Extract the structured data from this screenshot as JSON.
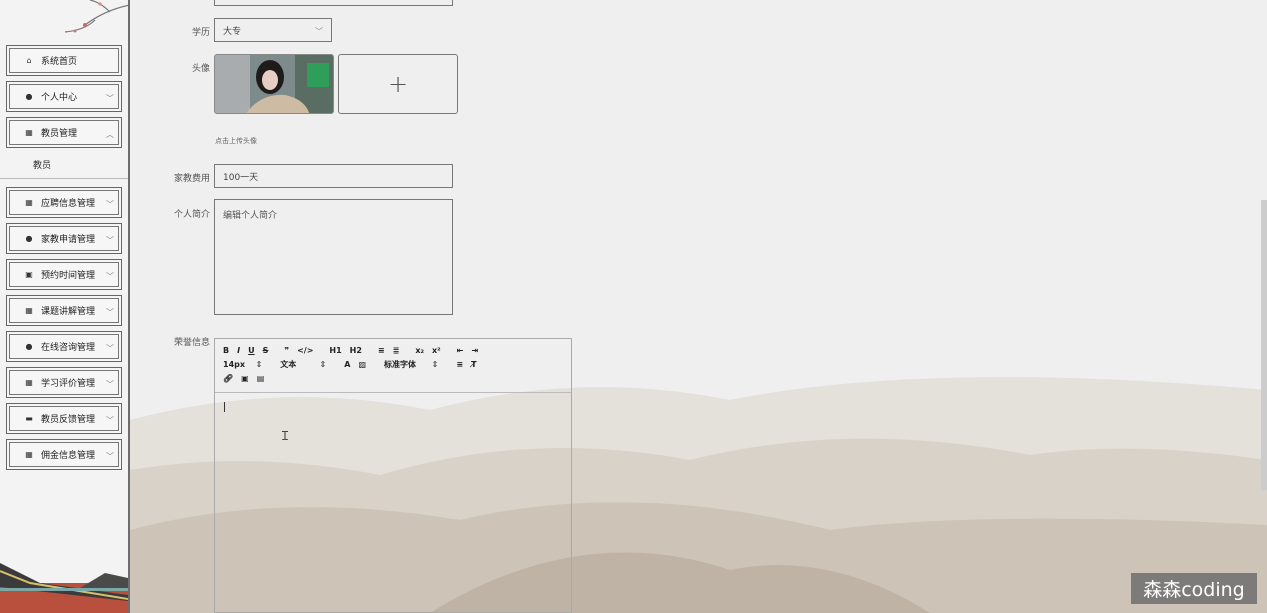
{
  "sidebar": {
    "items": [
      {
        "label": "系统首页",
        "icon": "home-icon",
        "chevron": false
      },
      {
        "label": "个人中心",
        "icon": "user-icon",
        "chevron": true
      },
      {
        "label": "教员管理",
        "icon": "grid-icon",
        "chevron": true,
        "expanded": true
      }
    ],
    "submenu_label": "教员",
    "items2": [
      {
        "label": "应聘信息管理",
        "icon": "grid-icon"
      },
      {
        "label": "家教申请管理",
        "icon": "user-icon"
      },
      {
        "label": "预约时间管理",
        "icon": "calendar-icon"
      },
      {
        "label": "课题讲解管理",
        "icon": "grid-icon"
      },
      {
        "label": "在线咨询管理",
        "icon": "user-icon"
      },
      {
        "label": "学习评价管理",
        "icon": "grid-icon"
      },
      {
        "label": "教员反馈管理",
        "icon": "chat-icon"
      },
      {
        "label": "佣金信息管理",
        "icon": "grid-icon"
      }
    ]
  },
  "form": {
    "education_label": "学历",
    "education_value": "大专",
    "avatar_label": "头像",
    "upload_plus": "+",
    "upload_hint": "点击上传头像",
    "fee_label": "家教费用",
    "fee_value": "100一天",
    "intro_label": "个人简介",
    "intro_placeholder": "编辑个人简介",
    "honor_label": "荣誉信息"
  },
  "editor": {
    "font_size": "14px",
    "text_type": "文本",
    "font_family": "标准字体",
    "buttons": [
      "B",
      "I",
      "U",
      "S",
      "❞",
      "</>",
      "H1",
      "H2",
      "≡",
      "≣",
      "x₂",
      "x²",
      "⇤",
      "⇥"
    ]
  },
  "watermark": "森森coding",
  "colors": {
    "accent": "#6d6d6d",
    "background": "#efefef"
  }
}
